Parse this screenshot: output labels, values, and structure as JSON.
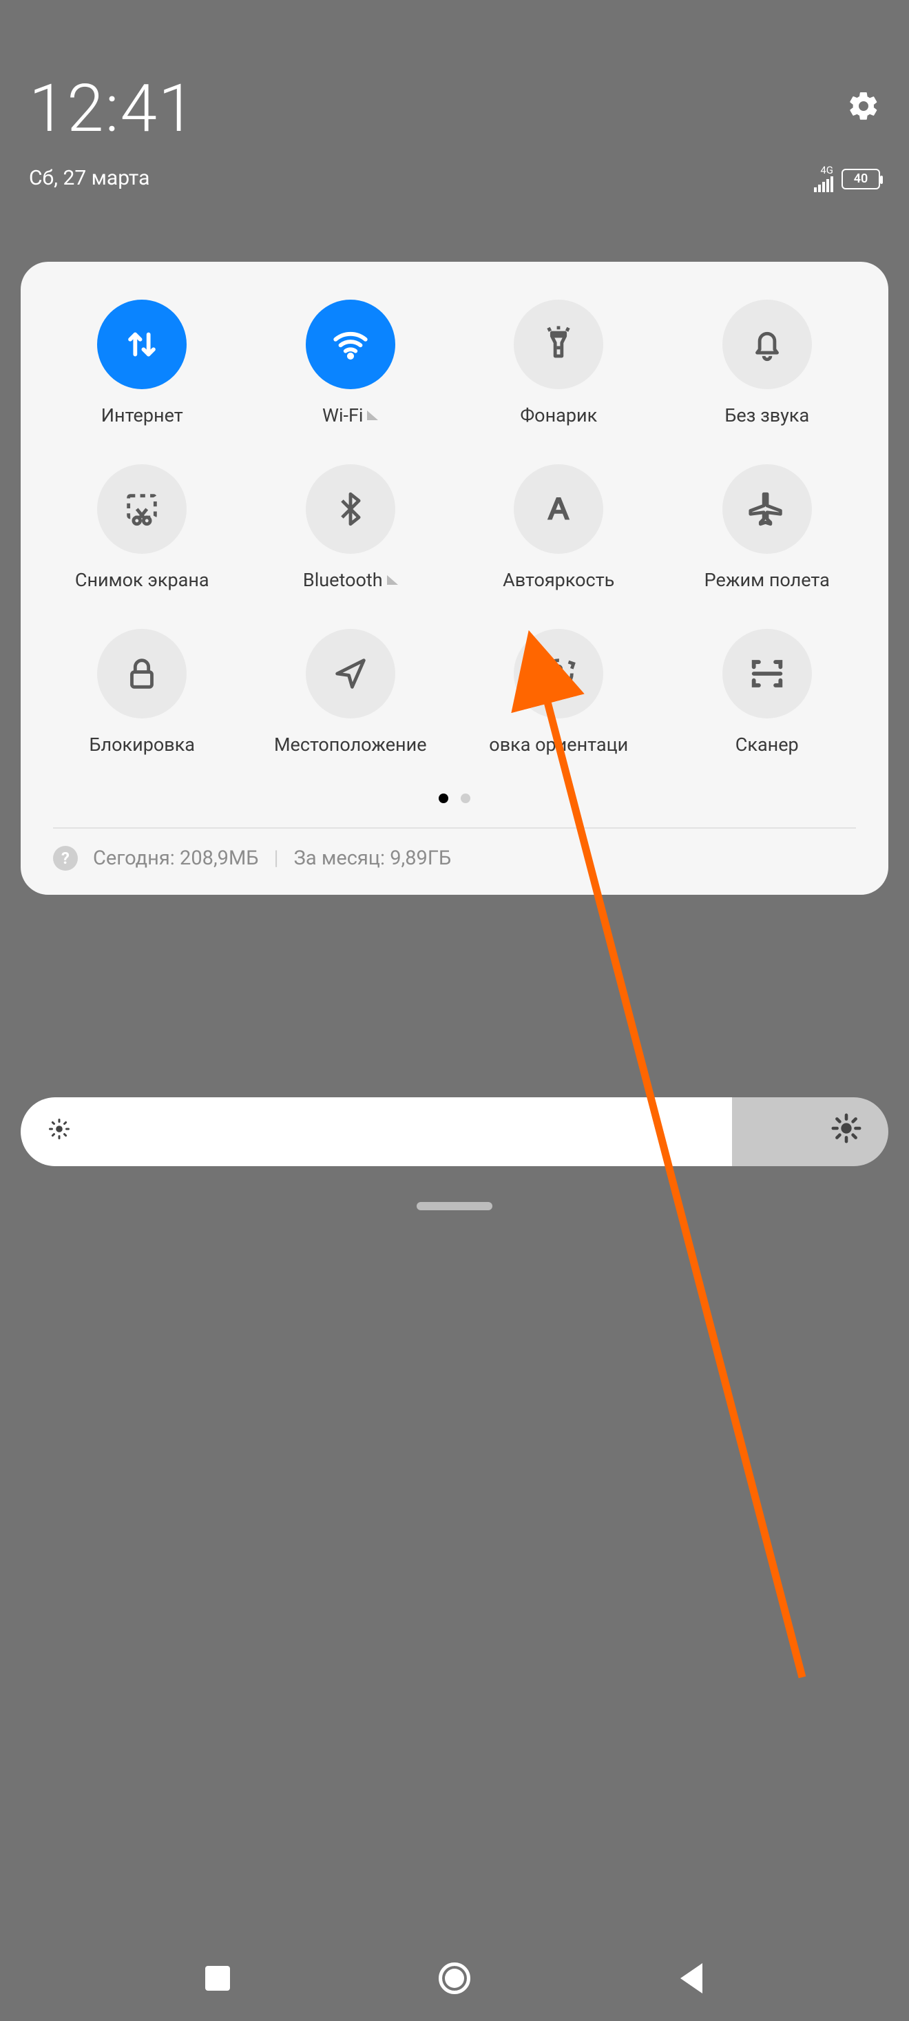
{
  "header": {
    "time": "12:41",
    "date": "Сб, 27 марта",
    "network_label": "4G",
    "battery_pct": "40"
  },
  "tiles": [
    {
      "id": "internet",
      "label": "Интернет",
      "icon": "data-arrows",
      "on": true,
      "expand": false
    },
    {
      "id": "wifi",
      "label": "Wi-Fi",
      "icon": "wifi",
      "on": true,
      "expand": true
    },
    {
      "id": "flashlight",
      "label": "Фонарик",
      "icon": "flashlight",
      "on": false,
      "expand": false
    },
    {
      "id": "mute",
      "label": "Без звука",
      "icon": "bell",
      "on": false,
      "expand": false
    },
    {
      "id": "screenshot",
      "label": "Снимок экрана",
      "icon": "scissors",
      "on": false,
      "expand": false
    },
    {
      "id": "bluetooth",
      "label": "Bluetooth",
      "icon": "bluetooth",
      "on": false,
      "expand": true
    },
    {
      "id": "autobright",
      "label": "Автояркость",
      "icon": "letter-a",
      "on": false,
      "expand": false
    },
    {
      "id": "airplane",
      "label": "Режим полета",
      "icon": "airplane",
      "on": false,
      "expand": false
    },
    {
      "id": "lock",
      "label": "Блокировка",
      "icon": "lock",
      "on": false,
      "expand": false
    },
    {
      "id": "location",
      "label": "Местоположение",
      "icon": "nav-arrow",
      "on": false,
      "expand": false
    },
    {
      "id": "rotation",
      "label": "овка ориентаци",
      "icon": "rotation-lock",
      "on": false,
      "expand": false
    },
    {
      "id": "scanner",
      "label": "Сканер",
      "icon": "scan",
      "on": false,
      "expand": false
    }
  ],
  "pagination": {
    "total": 2,
    "active": 0
  },
  "usage": {
    "today_label": "Сегодня:",
    "today_value": "208,9МБ",
    "month_label": "За месяц:",
    "month_value": "9,89ГБ"
  },
  "brightness": {
    "percent": 82
  },
  "annotation": {
    "target_tile": "autobright",
    "color": "#ff6600"
  }
}
